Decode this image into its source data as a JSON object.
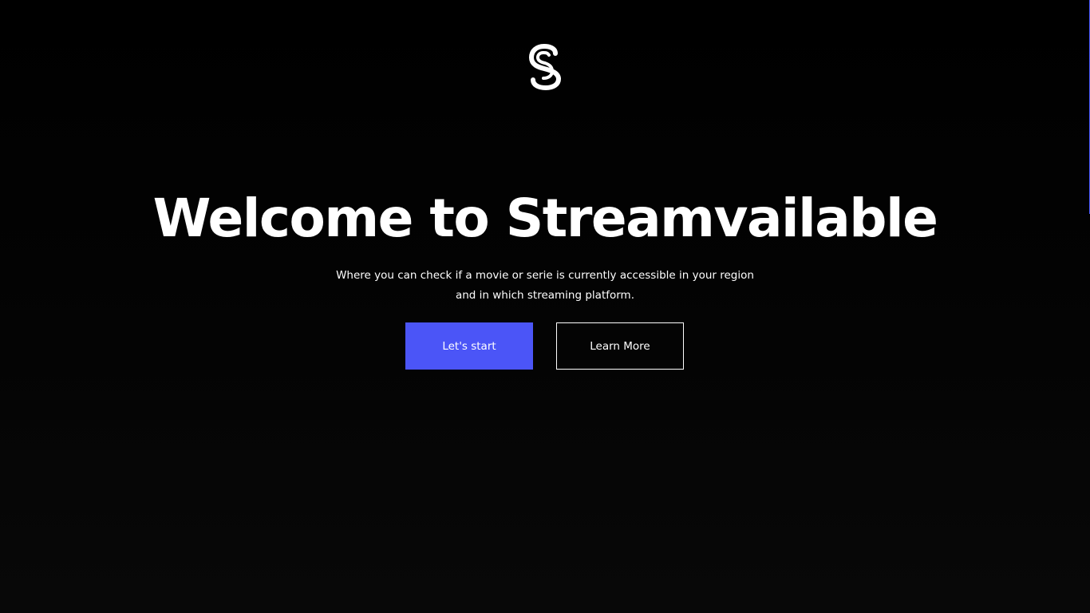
{
  "logo": {
    "icon": "streamvailable-s-logo-icon"
  },
  "hero": {
    "title": "Welcome to Streamvailable",
    "subtitle": "Where you can check if a movie or serie is currently accessible in your region and in which streaming platform."
  },
  "actions": {
    "primary_label": "Let's start",
    "secondary_label": "Learn More"
  },
  "colors": {
    "background": "#000000",
    "accent": "#4b55f7",
    "text": "#ffffff"
  }
}
